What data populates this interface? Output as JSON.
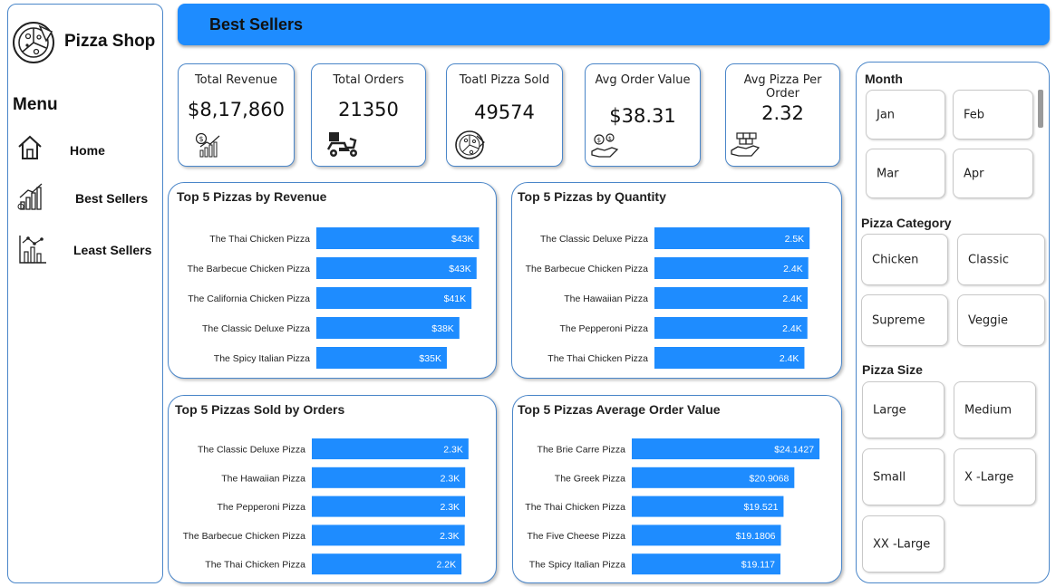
{
  "brand": "Pizza Shop",
  "menu": {
    "title": "Menu",
    "items": [
      {
        "label": "Home",
        "icon": "home-icon"
      },
      {
        "label": "Best Sellers",
        "icon": "bar-chart-icon"
      },
      {
        "label": "Least Sellers",
        "icon": "line-chart-icon"
      }
    ]
  },
  "header": {
    "title": "Best Sellers"
  },
  "kpis": [
    {
      "label": "Total Revenue",
      "value": "$8,17,860",
      "icon": "revenue-growth-icon"
    },
    {
      "label": "Total Orders",
      "value": "21350",
      "icon": "delivery-scooter-icon"
    },
    {
      "label": "Toatl Pizza Sold",
      "value": "49574",
      "icon": "pizza-icon"
    },
    {
      "label": "Avg Order Value",
      "value": "$38.31",
      "icon": "money-hand-icon"
    },
    {
      "label": "Avg Pizza Per Order",
      "value": "2.32",
      "icon": "boxes-hand-icon"
    }
  ],
  "chart_data": [
    {
      "type": "bar",
      "title": "Top 5 Pizzas by Revenue",
      "categories": [
        "The Thai Chicken Pizza",
        "The Barbecue Chicken Pizza",
        "The California Chicken Pizza",
        "The Classic Deluxe Pizza",
        "The Spicy Italian Pizza"
      ],
      "values": [
        43434,
        42768,
        41410,
        38180,
        34831
      ],
      "labels": [
        "$43K",
        "$43K",
        "$41K",
        "$38K",
        "$35K"
      ],
      "orientation": "horizontal",
      "color": "#1e8cff"
    },
    {
      "type": "bar",
      "title": "Top 5 Pizzas by Quantity",
      "categories": [
        "The Classic Deluxe Pizza",
        "The Barbecue Chicken Pizza",
        "The Hawaiian Pizza",
        "The Pepperoni Pizza",
        "The Thai Chicken Pizza"
      ],
      "values": [
        2453,
        2432,
        2422,
        2418,
        2371
      ],
      "labels": [
        "2.5K",
        "2.4K",
        "2.4K",
        "2.4K",
        "2.4K"
      ],
      "orientation": "horizontal",
      "color": "#1e8cff"
    },
    {
      "type": "bar",
      "title": "Top 5 Pizzas Sold by Orders",
      "categories": [
        "The Classic Deluxe Pizza",
        "The Hawaiian Pizza",
        "The Pepperoni Pizza",
        "The Barbecue Chicken Pizza",
        "The Thai Chicken Pizza"
      ],
      "values": [
        2329,
        2280,
        2278,
        2273,
        2225
      ],
      "labels": [
        "2.3K",
        "2.3K",
        "2.3K",
        "2.3K",
        "2.2K"
      ],
      "orientation": "horizontal",
      "color": "#1e8cff"
    },
    {
      "type": "bar",
      "title": "Top 5 Pizzas Average Order Value",
      "categories": [
        "The Brie Carre Pizza",
        "The Greek Pizza",
        "The Thai Chicken Pizza",
        "The Five Cheese Pizza",
        "The Spicy Italian Pizza"
      ],
      "values": [
        24.1427,
        20.9068,
        19.521,
        19.1806,
        19.117
      ],
      "labels": [
        "$24.1427",
        "$20.9068",
        "$19.521",
        "$19.1806",
        "$19.117"
      ],
      "orientation": "horizontal",
      "color": "#1e8cff"
    }
  ],
  "filters": {
    "month": {
      "title": "Month",
      "options": [
        "Jan",
        "Feb",
        "Mar",
        "Apr"
      ]
    },
    "category": {
      "title": "Pizza Category",
      "options": [
        "Chicken",
        "Classic",
        "Supreme",
        "Veggie"
      ]
    },
    "size": {
      "title": "Pizza Size",
      "options": [
        "Large",
        "Medium",
        "Small",
        "X -Large",
        "XX -Large"
      ]
    }
  }
}
